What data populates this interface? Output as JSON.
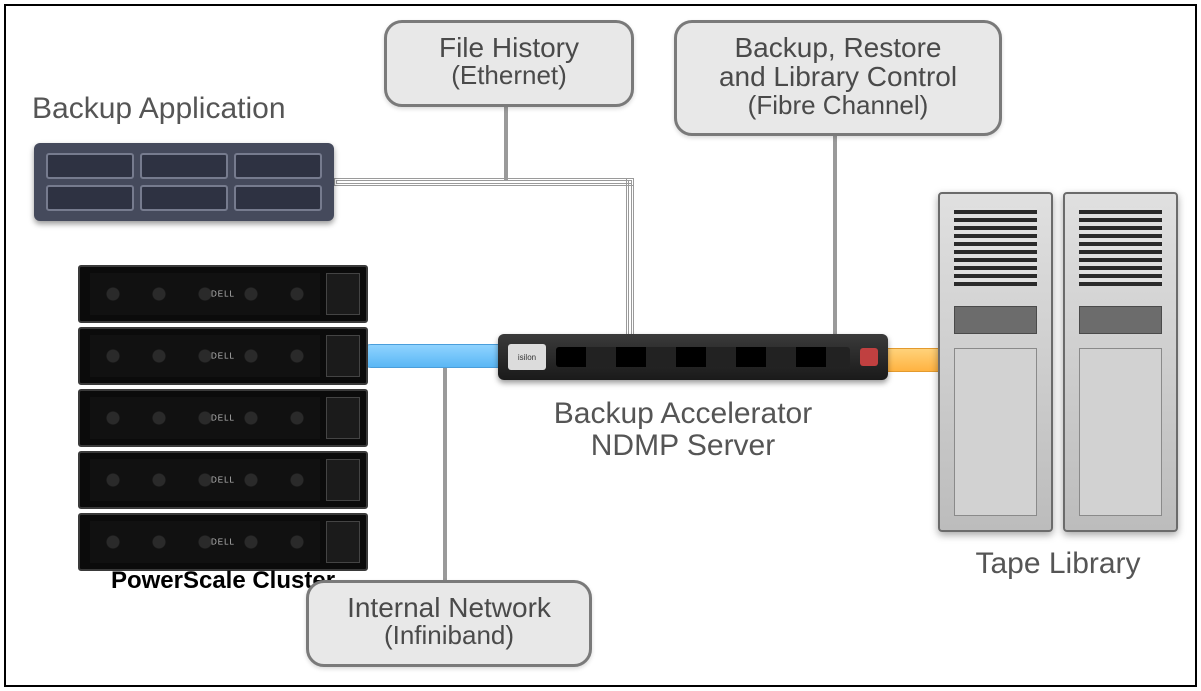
{
  "labels": {
    "backup_app": "Backup Application",
    "file_history": {
      "title": "File History",
      "sub": "(Ethernet)"
    },
    "backup_restore": {
      "title": "Backup, Restore\nand Library Control",
      "sub": "(Fibre Channel)"
    },
    "accel": {
      "line1": "Backup Accelerator",
      "line2": "NDMP Server"
    },
    "internal_net": {
      "title": "Internal Network",
      "sub": "(Infiniband)"
    },
    "tape": "Tape Library",
    "cluster": "PowerScale Cluster"
  },
  "devices": {
    "backup_app_bays": 6,
    "cluster_node_logo": "DELL",
    "cluster_nodes": 5,
    "accel_badge": "isilon",
    "tape_units": 2
  },
  "connections": {
    "cluster_to_accel": "infiniband-blue",
    "accel_to_tape": "fibre-channel-orange",
    "app_to_accel": "ethernet-grey"
  }
}
